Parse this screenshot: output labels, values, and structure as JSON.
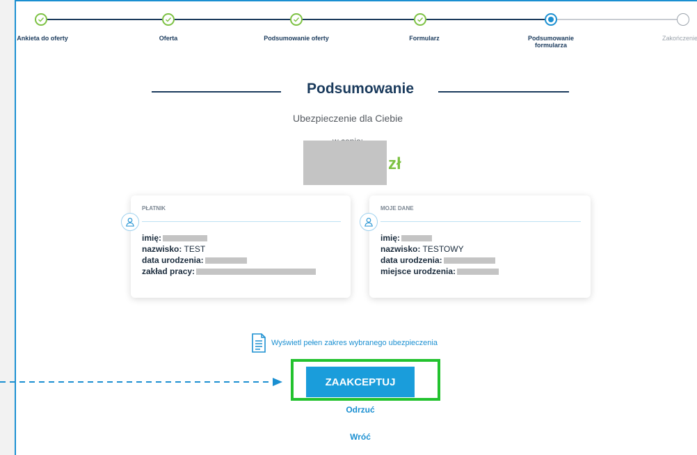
{
  "stepper": {
    "steps": [
      {
        "label": "Ankieta do oferty",
        "state": "done"
      },
      {
        "label": "Oferta",
        "state": "done"
      },
      {
        "label": "Podsumowanie oferty",
        "state": "done"
      },
      {
        "label": "Formularz",
        "state": "done"
      },
      {
        "label": "Podsumowanie formularza",
        "state": "active"
      },
      {
        "label": "Zakończenie",
        "state": "todo"
      }
    ]
  },
  "summary": {
    "title": "Podsumowanie",
    "subtitle": "Ubezpieczenie dla Ciebie",
    "price_prefix": "w cenie:",
    "currency": "zł"
  },
  "payer_card": {
    "title": "PŁATNIK",
    "rows": [
      {
        "label": "imię:",
        "value": ""
      },
      {
        "label": "nazwisko:",
        "value": "TEST"
      },
      {
        "label": "data urodzenia:",
        "value": ""
      },
      {
        "label": "zakład pracy:",
        "value": ""
      }
    ]
  },
  "my_data_card": {
    "title": "MOJE DANE",
    "rows": [
      {
        "label": "imię:",
        "value": ""
      },
      {
        "label": "nazwisko:",
        "value": "TESTOWY"
      },
      {
        "label": "data urodzenia:",
        "value": ""
      },
      {
        "label": "miejsce urodzenia:",
        "value": ""
      }
    ]
  },
  "actions": {
    "doc_link": "Wyświetl pełen zakres wybranego ubezpieczenia",
    "accept": "ZAAKCEPTUJ",
    "reject": "Odrzuć",
    "back": "Wróć"
  },
  "colors": {
    "primary": "#1a9ddb",
    "done": "#7cc142",
    "highlight": "#22c22e",
    "navy": "#1a3a5c"
  }
}
